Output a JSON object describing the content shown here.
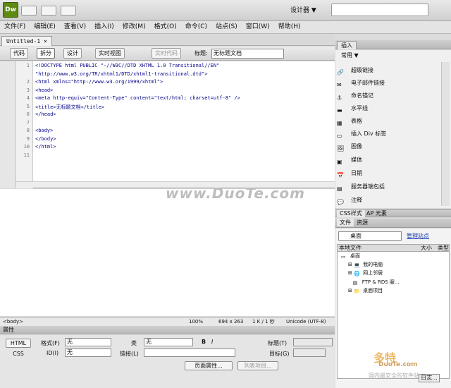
{
  "app": {
    "logo": "Dw",
    "workspace": "设计器",
    "workspace_caret": "▼"
  },
  "menu": [
    "文件(F)",
    "编辑(E)",
    "查看(V)",
    "插入(I)",
    "修改(M)",
    "格式(O)",
    "命令(C)",
    "站点(S)",
    "窗口(W)",
    "帮助(H)"
  ],
  "document": {
    "tab": "Untitled-1",
    "tab_close": "×",
    "views": {
      "code": "代码",
      "split": "拆分",
      "design": "设计",
      "live_view": "实时视图",
      "live_code": "实时代码"
    },
    "title_label": "标题:",
    "title_value": "无标题文档"
  },
  "code_lines": [
    "<!DOCTYPE html PUBLIC \"-//W3C//DTD XHTML 1.0 Transitional//EN\"",
    "\"http://www.w3.org/TR/xhtml1/DTD/xhtml1-transitional.dtd\">",
    "<html xmlns=\"http://www.w3.org/1999/xhtml\">",
    "<head>",
    "<meta http-equiv=\"Content-Type\" content=\"text/html; charset=utf-8\" />",
    "<title>无标题文档</title>",
    "</head>",
    "",
    "<body>",
    "</body>",
    "</html>",
    ""
  ],
  "line_numbers": [
    "1",
    "",
    "2",
    "3",
    "4",
    "5",
    "6",
    "7",
    "8",
    "9",
    "10",
    "11"
  ],
  "watermark": "www.DuoTe.com",
  "status": {
    "tag": "<body>",
    "zoom": "100%",
    "dims": "694 x 263",
    "size": "1 K / 1 秒",
    "encoding": "Unicode (UTF-8)"
  },
  "properties": {
    "header": "属性",
    "html_btn": "HTML",
    "css_btn": "CSS",
    "format_label": "格式(F)",
    "format_value": "无",
    "class_label": "类",
    "class_value": "无",
    "bold": "B",
    "italic": "I",
    "title_label": "标题(T)",
    "id_label": "ID(I)",
    "id_value": "无",
    "link_label": "链接(L)",
    "target_label": "目标(G)",
    "page_props_btn": "页面属性...",
    "list_item_btn": "列表项目..."
  },
  "insert": {
    "tab": "插入",
    "category": "常用",
    "items": [
      "超级链接",
      "电子邮件链接",
      "命名锚记",
      "水平线",
      "表格",
      "插入 Div 标签",
      "图像",
      "媒体",
      "日期",
      "服务器端包括",
      "注释"
    ]
  },
  "css_tabs": [
    "CSS样式",
    "AP 元素"
  ],
  "files": {
    "tabs": [
      "文件",
      "资源"
    ],
    "site": "桌面",
    "manage": "管理站点",
    "col_local": "本地文件",
    "col_size": "大小",
    "col_type": "类型",
    "tree": [
      {
        "label": "桌面",
        "level": 0
      },
      {
        "label": "我的电脑",
        "level": 1
      },
      {
        "label": "网上邻居",
        "level": 1
      },
      {
        "label": "FTP & RDS 服...",
        "level": 1
      },
      {
        "label": "桌面项目",
        "level": 1
      }
    ],
    "log": "日志..."
  },
  "watermark2": {
    "main": "多特",
    "sub": "DuoTe.com",
    "foot": "国内最安全的软件站"
  },
  "colors": {
    "accent": "#5e8a12",
    "code_blue": "#00008b",
    "link": "#2241b0"
  }
}
